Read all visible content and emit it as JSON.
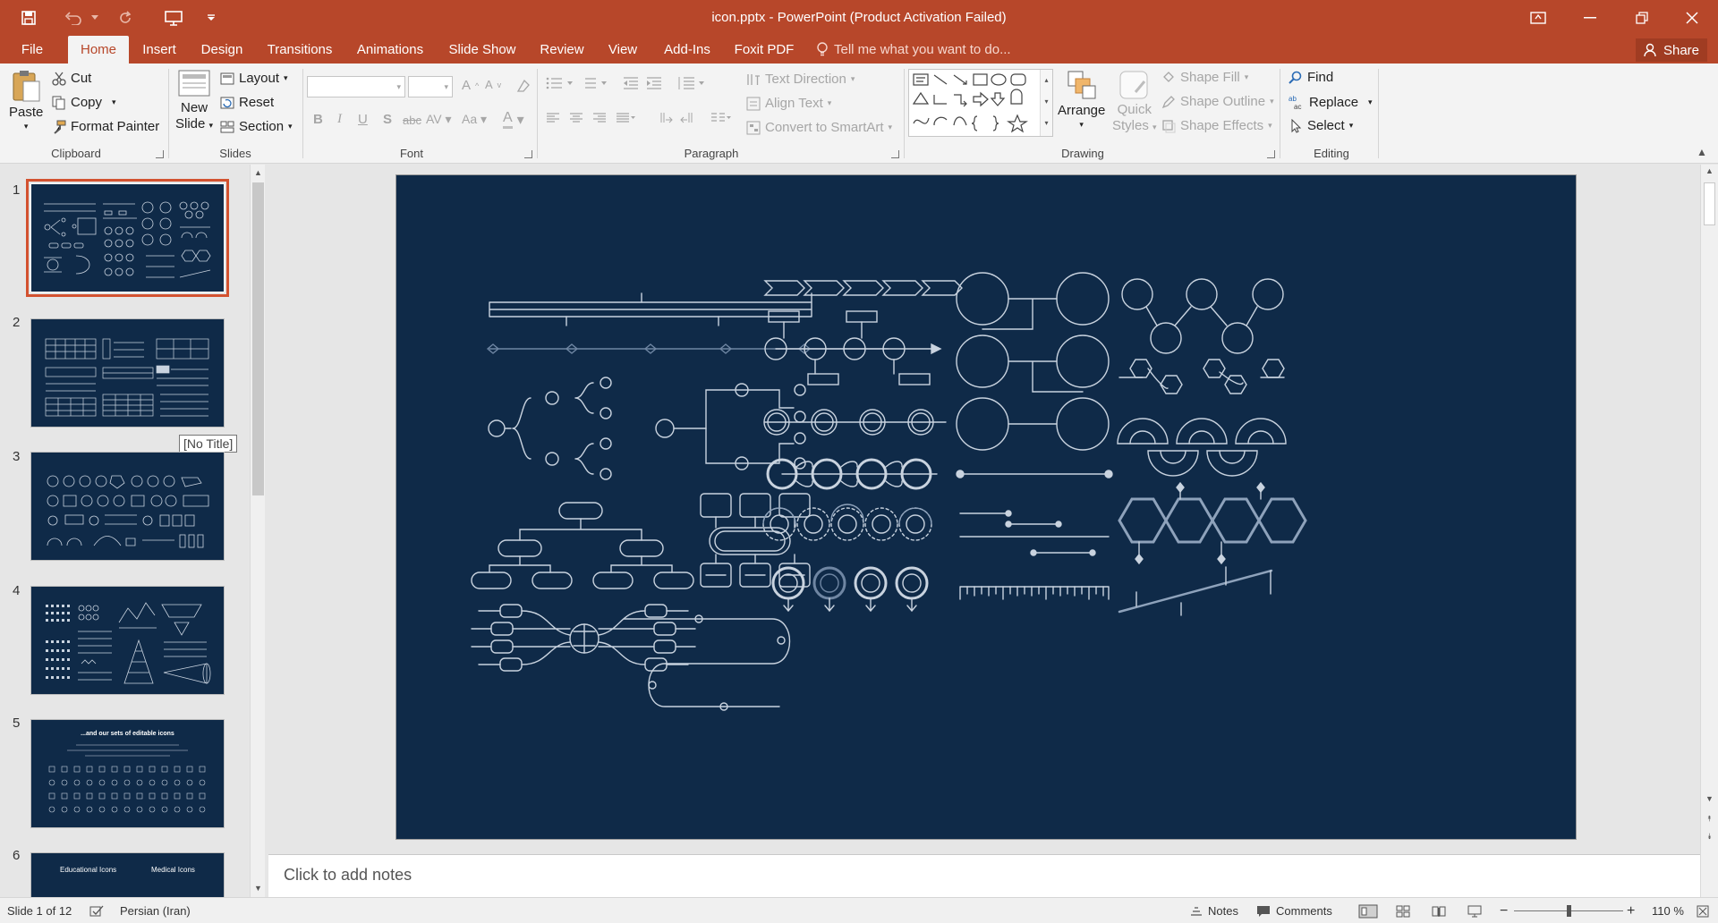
{
  "window": {
    "title": "icon.pptx - PowerPoint (Product Activation Failed)"
  },
  "tabs": [
    {
      "label": "File"
    },
    {
      "label": "Home"
    },
    {
      "label": "Insert"
    },
    {
      "label": "Design"
    },
    {
      "label": "Transitions"
    },
    {
      "label": "Animations"
    },
    {
      "label": "Slide Show"
    },
    {
      "label": "Review"
    },
    {
      "label": "View"
    },
    {
      "label": "Add-Ins"
    },
    {
      "label": "Foxit PDF"
    }
  ],
  "tell_me": "Tell me what you want to do...",
  "share": "Share",
  "ribbon": {
    "clipboard": {
      "paste": "Paste",
      "cut": "Cut",
      "copy": "Copy",
      "format_painter": "Format Painter",
      "label": "Clipboard"
    },
    "slides": {
      "new_slide": "New",
      "new_slide2": "Slide",
      "layout": "Layout",
      "reset": "Reset",
      "section": "Section",
      "label": "Slides"
    },
    "font": {
      "label": "Font"
    },
    "paragraph": {
      "text_direction": "Text Direction",
      "align_text": "Align Text",
      "convert_smartart": "Convert to SmartArt",
      "label": "Paragraph"
    },
    "drawing": {
      "arrange": "Arrange",
      "quick_styles": "Quick",
      "quick_styles2": "Styles",
      "shape_fill": "Shape Fill",
      "shape_outline": "Shape Outline",
      "shape_effects": "Shape Effects",
      "label": "Drawing"
    },
    "editing": {
      "find": "Find",
      "replace": "Replace",
      "select": "Select",
      "label": "Editing"
    }
  },
  "thumbnails": [
    {
      "number": "1"
    },
    {
      "number": "2"
    },
    {
      "number": "3"
    },
    {
      "number": "4"
    },
    {
      "number": "5",
      "caption": "...and our sets of editable icons"
    },
    {
      "number": "6",
      "caption_left": "Educational Icons",
      "caption_right": "Medical Icons"
    }
  ],
  "tooltip": "[No Title]",
  "notes_placeholder": "Click to add notes",
  "status": {
    "slide": "Slide 1 of 12",
    "language": "Persian (Iran)",
    "notes": "Notes",
    "comments": "Comments",
    "zoom": "110 %"
  },
  "colors": {
    "accent": "#b7472a",
    "slide_bg": "#0f2a48",
    "slide_line": "#c9d3df"
  }
}
